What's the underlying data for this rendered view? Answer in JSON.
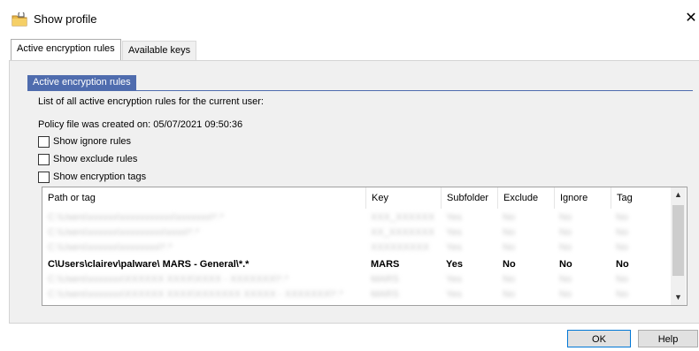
{
  "window": {
    "title": "Show profile",
    "close_glyph": "✕",
    "icon": "folder-lock-icon"
  },
  "tabs": [
    {
      "label": "Active encryption rules",
      "active": true
    },
    {
      "label": "Available keys",
      "active": false
    }
  ],
  "group": {
    "header": "Active encryption rules"
  },
  "description": "List of all active encryption rules for the current user:",
  "policy_text": "Policy file was created on: 05/07/2021  09:50:36",
  "checkboxes": [
    {
      "label": "Show ignore rules",
      "checked": false
    },
    {
      "label": "Show exclude rules",
      "checked": false
    },
    {
      "label": "Show encryption tags",
      "checked": false
    }
  ],
  "table": {
    "columns": [
      "Path or tag",
      "Key",
      "Subfolder",
      "Exclude",
      "Ignore",
      "Tag"
    ],
    "rows": [
      {
        "cells": [
          "C:\\Users\\xxxxxx\\xxxxxxxxxxx\\xxxxxxx\\*.*",
          "XXX_XXXXXX",
          "Yes",
          "No",
          "No",
          "No"
        ],
        "blurred": true
      },
      {
        "cells": [
          "C:\\Users\\xxxxxx\\xxxxxxxxx\\xxxx\\*.*",
          "XX_XXXXXXX",
          "Yes",
          "No",
          "No",
          "No"
        ],
        "blurred": true
      },
      {
        "cells": [
          "C:\\Users\\xxxxxx\\xxxxxxxx\\*.*",
          "XXXXXXXXX",
          "Yes",
          "No",
          "No",
          "No"
        ],
        "blurred": true
      },
      {
        "cells": [
          "C\\Users\\clairev\\palware\\ MARS - General\\*.*",
          "MARS",
          "Yes",
          "No",
          "No",
          "No"
        ],
        "blurred": false
      },
      {
        "cells": [
          "C:\\Users\\xxxxxxx\\XXXXXX XXXX\\XXXX - XXXXXXX\\*.*",
          "MARS",
          "Yes",
          "No",
          "No",
          "No"
        ],
        "blurred": true
      },
      {
        "cells": [
          "C:\\Users\\xxxxxxx\\XXXXXX XXXX\\XXXXXXX XXXXX - XXXXXXX\\*.*",
          "MARS",
          "Yes",
          "No",
          "No",
          "No"
        ],
        "blurred": true
      }
    ]
  },
  "scrollbar": {
    "up_glyph": "▲",
    "down_glyph": "▼"
  },
  "buttons": {
    "ok": "OK",
    "help": "Help"
  }
}
